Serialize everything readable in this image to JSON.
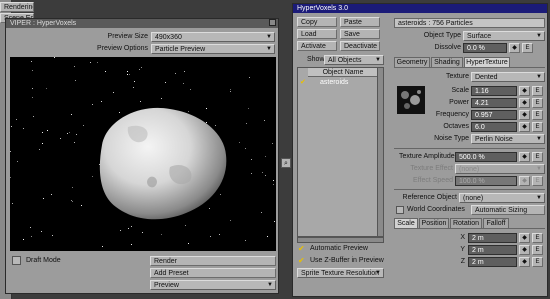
{
  "bg_menu": {
    "items": [
      "Rendering",
      "Scene Editor"
    ]
  },
  "viper": {
    "title": "VIPER : HyperVoxels",
    "preview_size_label": "Preview Size",
    "preview_size_value": "490x360",
    "preview_options_label": "Preview Options",
    "preview_options_value": "Particle Preview",
    "draft_mode_label": "Draft Mode",
    "render_label": "Render",
    "add_preset_label": "Add Preset",
    "preview_menu_label": "Preview"
  },
  "hv": {
    "title": "HyperVoxels 3.0",
    "buttons": {
      "copy": "Copy",
      "paste": "Paste",
      "load": "Load",
      "save": "Save",
      "activate": "Activate",
      "deactivate": "Deactivate"
    },
    "show_label": "Show",
    "show_value": "All Objects",
    "column_header": "Object Name",
    "objects": [
      {
        "name": "asteroids",
        "checked": true
      }
    ],
    "automatic_preview": "Automatic Preview",
    "use_zbuffer": "Use Z-Buffer in Preview",
    "sprite_texture_resolution": "Sprite Texture Resolution",
    "object_info": "asteroids : 756 Particles",
    "object_type_label": "Object Type",
    "object_type_value": "Surface",
    "dissolve_label": "Dissolve",
    "dissolve_value": "0.0 %",
    "tabs": [
      "Geometry",
      "Shading",
      "HyperTexture"
    ],
    "active_tab": "HyperTexture",
    "texture_label": "Texture",
    "texture_value": "Dented",
    "scale_label": "Scale",
    "scale_value": "1.16",
    "power_label": "Power",
    "power_value": "4.21",
    "frequency_label": "Frequency",
    "frequency_value": "0.957",
    "octaves_label": "Octaves",
    "octaves_value": "6.0",
    "noise_type_label": "Noise Type",
    "noise_type_value": "Perlin Noise",
    "texture_amplitude_label": "Texture Amplitude",
    "texture_amplitude_value": "500.0 %",
    "texture_effect_label": "Texture Effect",
    "texture_effect_value": "(none)",
    "effect_speed_label": "Effect Speed",
    "effect_speed_value": "100.0 %",
    "reference_object_label": "Reference Object",
    "reference_object_value": "(none)",
    "world_coordinates_label": "World Coordinates",
    "automatic_sizing_label": "Automatic Sizing",
    "sub_tabs": [
      "Scale",
      "Position",
      "Rotation",
      "Falloff"
    ],
    "active_sub_tab": "Scale",
    "x_label": "X",
    "x_value": "2 m",
    "y_label": "Y",
    "y_value": "2 m",
    "z_label": "Z",
    "z_value": "2 m",
    "env_label": "E"
  },
  "colors": {
    "title_active": "#1b1b78",
    "panel": "#9c9c9c",
    "field": "#5f5f5f",
    "check": "#e8c000"
  }
}
